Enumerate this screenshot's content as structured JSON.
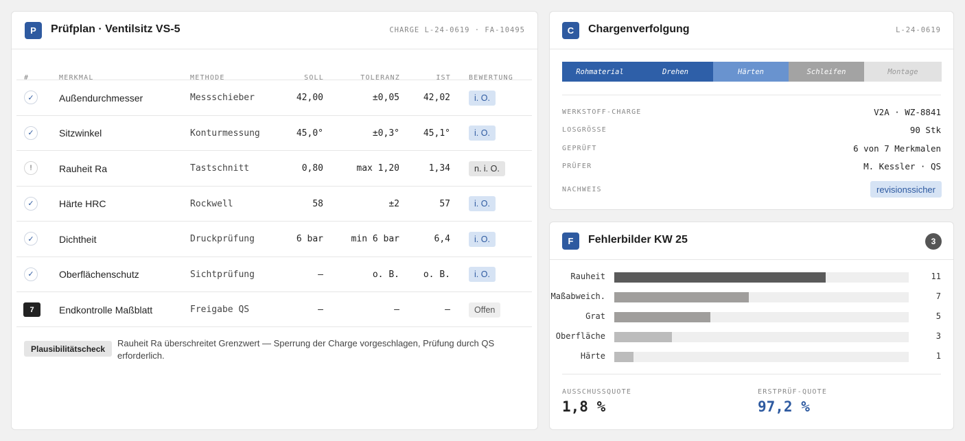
{
  "pruefplan": {
    "badge": "P",
    "title": "Prüfplan · Ventilsitz VS-5",
    "meta": "CHARGE L-24-0619 · FA-10495",
    "columns": {
      "num": "#",
      "merkmal": "MERKMAL",
      "methode": "METHODE",
      "soll": "SOLL",
      "toleranz": "TOLERANZ",
      "ist": "IST",
      "bewertung": "BEWERTUNG"
    },
    "rows": [
      {
        "status": "check",
        "icon_text": "✓",
        "merkmal": "Außendurchmesser",
        "methode": "Messschieber",
        "soll": "42,00",
        "toleranz": "±0,05",
        "ist": "42,02",
        "bewertung": "i. O.",
        "bewertung_type": "ok"
      },
      {
        "status": "check",
        "icon_text": "✓",
        "merkmal": "Sitzwinkel",
        "methode": "Konturmessung",
        "soll": "45,0°",
        "toleranz": "±0,3°",
        "ist": "45,1°",
        "bewertung": "i. O.",
        "bewertung_type": "ok"
      },
      {
        "status": "warn",
        "icon_text": "!",
        "merkmal": "Rauheit Ra",
        "methode": "Tastschnitt",
        "soll": "0,80",
        "toleranz": "max 1,20",
        "ist": "1,34",
        "bewertung": "n. i. O.",
        "bewertung_type": "nok"
      },
      {
        "status": "check",
        "icon_text": "✓",
        "merkmal": "Härte HRC",
        "methode": "Rockwell",
        "soll": "58",
        "toleranz": "±2",
        "ist": "57",
        "bewertung": "i. O.",
        "bewertung_type": "ok"
      },
      {
        "status": "check",
        "icon_text": "✓",
        "merkmal": "Dichtheit",
        "methode": "Druckprüfung",
        "soll": "6 bar",
        "toleranz": "min 6 bar",
        "ist": "6,4",
        "bewertung": "i. O.",
        "bewertung_type": "ok"
      },
      {
        "status": "check",
        "icon_text": "✓",
        "merkmal": "Oberflächenschutz",
        "methode": "Sichtprüfung",
        "soll": "—",
        "toleranz": "o. B.",
        "ist": "o. B.",
        "bewertung": "i. O.",
        "bewertung_type": "ok"
      },
      {
        "status": "num",
        "icon_text": "7",
        "merkmal": "Endkontrolle Maßblatt",
        "methode": "Freigabe QS",
        "soll": "—",
        "toleranz": "—",
        "ist": "—",
        "bewertung": "Offen",
        "bewertung_type": "open"
      }
    ],
    "plausibility": {
      "button": "Plausibilitätscheck",
      "text": "Rauheit Ra überschreitet Grenzwert — Sperrung der Charge vorgeschlagen, Prüfung durch QS erforderlich."
    }
  },
  "charge": {
    "badge": "C",
    "title": "Chargenverfolgung",
    "meta": "L-24-0619",
    "stages": [
      {
        "label": "Rohmaterial",
        "state": "done"
      },
      {
        "label": "Drehen",
        "state": "done"
      },
      {
        "label": "Härten",
        "state": "active"
      },
      {
        "label": "Schleifen",
        "state": "pending"
      },
      {
        "label": "Montage",
        "state": "future"
      }
    ],
    "stage_colors": {
      "done": "#2e5fa8",
      "active": "#6993cf",
      "pending": "#a3a3a3",
      "future": "#e2e2e2"
    },
    "fields": [
      {
        "label": "WERKSTOFF-CHARGE",
        "value": "V2A · WZ-8841"
      },
      {
        "label": "LOSGRÖSSE",
        "value": "90 Stk"
      },
      {
        "label": "GEPRÜFT",
        "value": "6 von 7 Merkmalen"
      },
      {
        "label": "PRÜFER",
        "value": "M. Kessler · QS"
      }
    ],
    "nachweis_label": "NACHWEIS",
    "nachweis_value": "revisionssicher"
  },
  "fehler": {
    "badge": "F",
    "title": "Fehlerbilder KW 25",
    "count": "3",
    "chart_data": {
      "type": "bar",
      "orientation": "horizontal",
      "categories": [
        "Rauheit",
        "Maßabweich.",
        "Grat",
        "Oberfläche",
        "Härte"
      ],
      "values": [
        11,
        7,
        5,
        3,
        1
      ],
      "xlim": [
        0,
        15.3
      ],
      "colors": [
        "#5a5a5a",
        "#a09e9c",
        "#a09e9c",
        "#bcbcbc",
        "#bcbcbc"
      ]
    },
    "kpis": [
      {
        "label": "AUSSCHUSSQUOTE",
        "value": "1,8 %",
        "color": "#222222"
      },
      {
        "label": "ERSTPRÜF-QUOTE",
        "value": "97,2 %",
        "color": "#2e5aa0"
      }
    ]
  }
}
